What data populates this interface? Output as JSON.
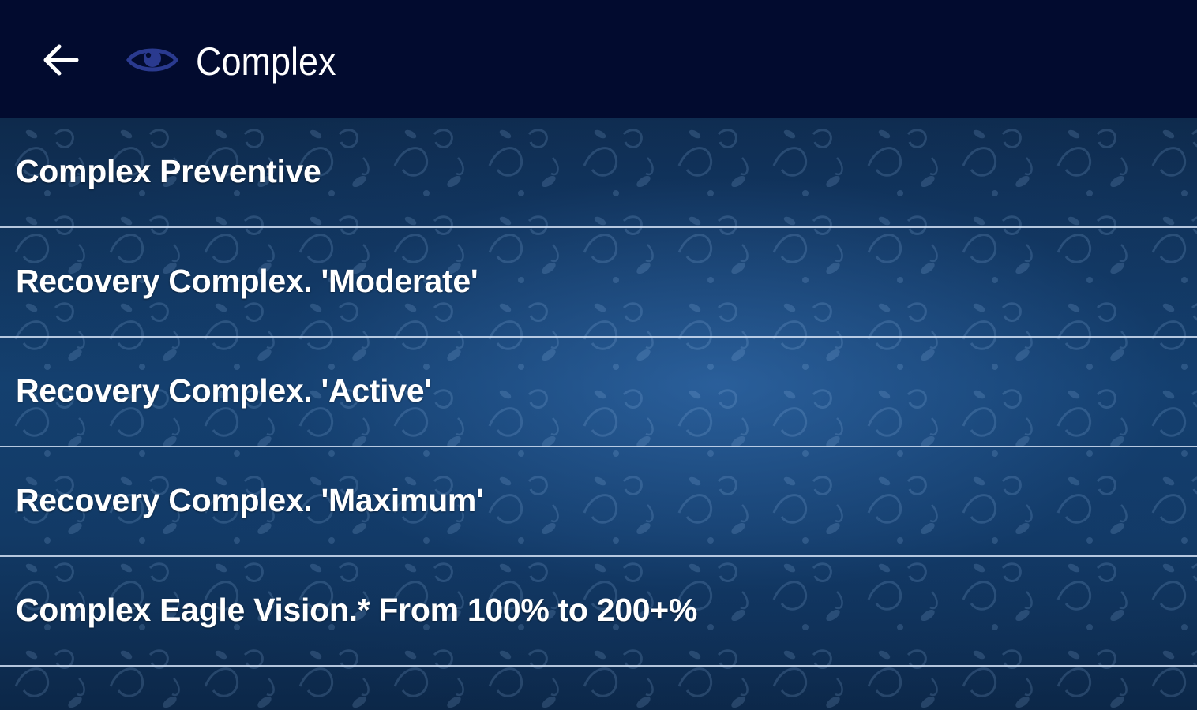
{
  "header": {
    "title": "Complex",
    "back_icon": "arrow-left-icon",
    "app_icon": "eye-icon"
  },
  "colors": {
    "app_bar": "#020b2f",
    "eye_icon": "#2a3a8f",
    "text": "#ffffff",
    "divider": "#d2e1f5",
    "background": "#14406f"
  },
  "menu": {
    "items": [
      {
        "label": "Complex Preventive"
      },
      {
        "label": "Recovery Complex. 'Moderate'"
      },
      {
        "label": "Recovery Complex. 'Active'"
      },
      {
        "label": "Recovery Complex. 'Maximum'"
      },
      {
        "label": "Complex Eagle Vision.* From 100% to 200+%"
      }
    ]
  }
}
